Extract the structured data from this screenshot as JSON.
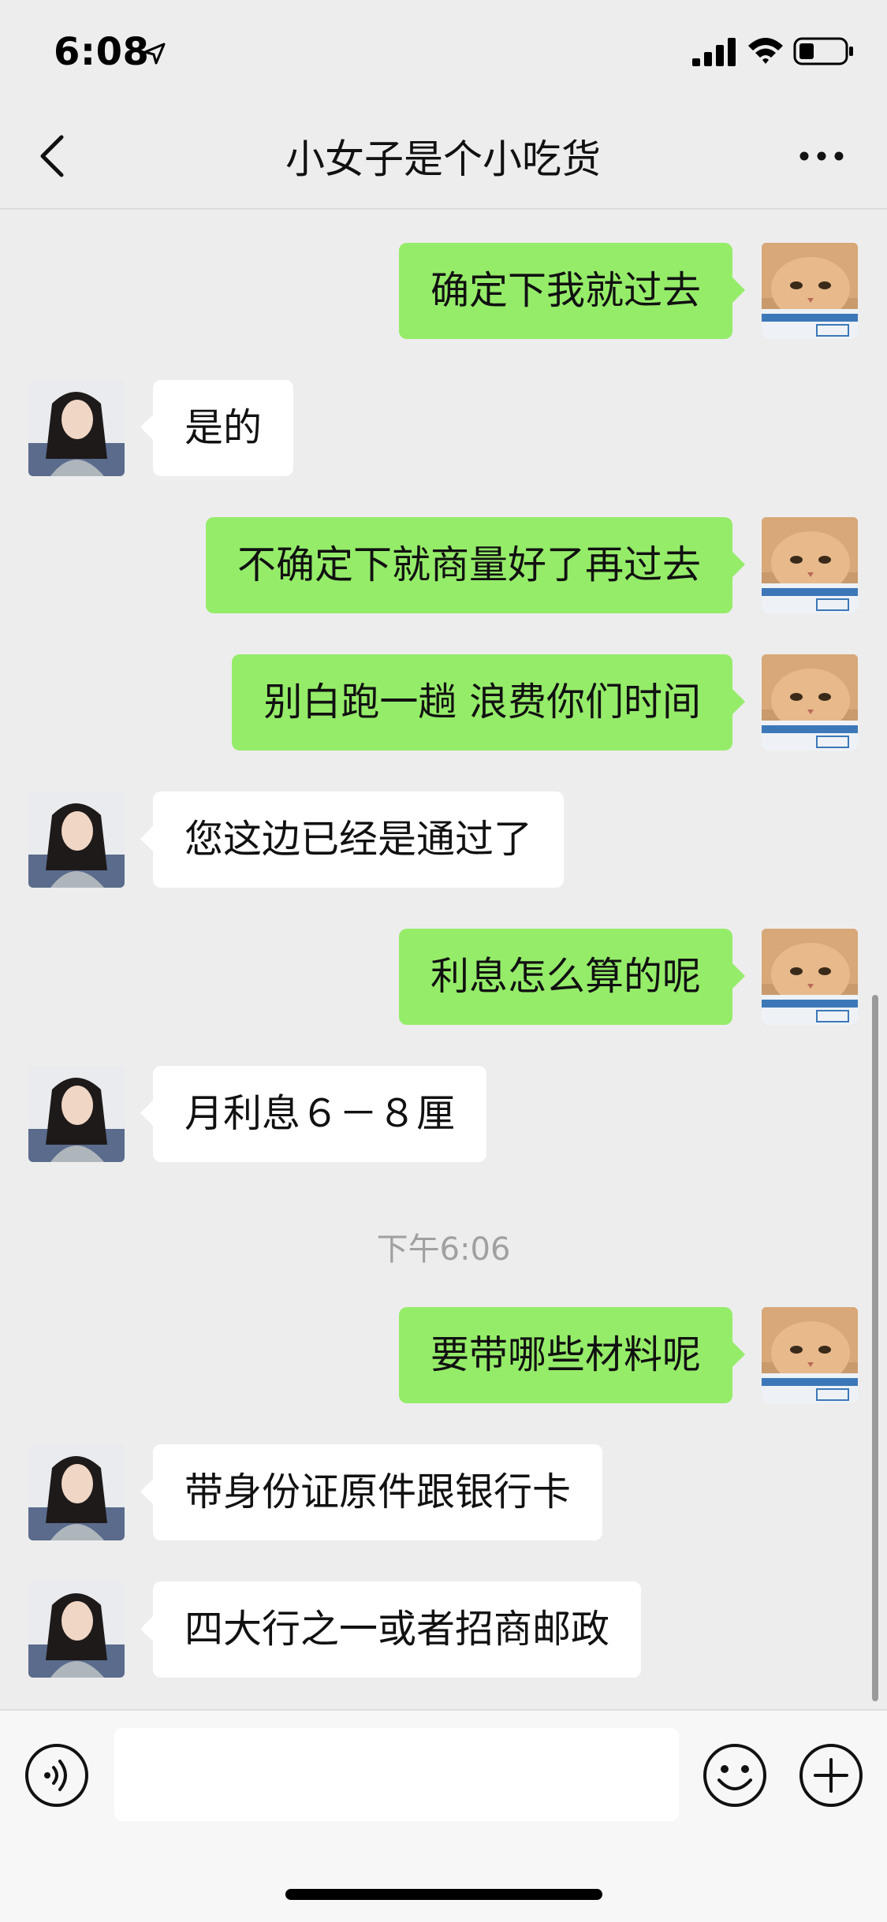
{
  "status_bar": {
    "time": "6:08"
  },
  "nav": {
    "title": "小女子是个小吃货"
  },
  "messages": [
    {
      "from": "self",
      "text": "确定下我就过去"
    },
    {
      "from": "other",
      "text": "是的"
    },
    {
      "from": "self",
      "text": "不确定下就商量好了再过去"
    },
    {
      "from": "self",
      "text": "别白跑一趟 浪费你们时间"
    },
    {
      "from": "other",
      "text": "您这边已经是通过了"
    },
    {
      "from": "self",
      "text": "利息怎么算的呢"
    },
    {
      "from": "other",
      "text": "月利息６－８厘"
    },
    {
      "from": "self",
      "text": "要带哪些材料呢"
    },
    {
      "from": "other",
      "text": "带身份证原件跟银行卡"
    },
    {
      "from": "other",
      "text": "四大行之一或者招商邮政"
    }
  ],
  "timestamp": "下午6:06",
  "input_bar": {
    "input_value": "",
    "voice_icon": "voice-icon",
    "emoji_icon": "emoji-icon",
    "plus_icon": "plus-icon"
  },
  "colors": {
    "self_bubble": "#95ec69",
    "other_bubble": "#ffffff",
    "background": "#ededed"
  }
}
